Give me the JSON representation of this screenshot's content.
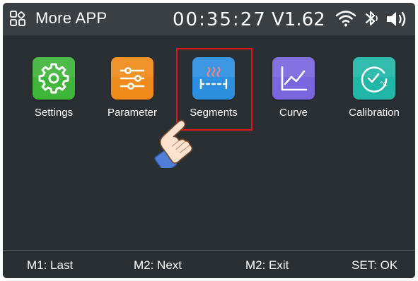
{
  "header": {
    "title": "More APP",
    "time": "00:35:27",
    "version": "V1.62",
    "icons": [
      "menu-icon",
      "wifi-icon",
      "bluetooth-icon",
      "volume-icon"
    ]
  },
  "apps": [
    {
      "label": "Settings",
      "icon": "gear-icon",
      "color": "#3fb53a"
    },
    {
      "label": "Parameter",
      "icon": "sliders-icon",
      "color": "#f08a1a"
    },
    {
      "label": "Segments",
      "icon": "heating-segments-icon",
      "color": "#2d8fe0",
      "selected": true
    },
    {
      "label": "Curve",
      "icon": "line-chart-icon",
      "color": "#7a67df"
    },
    {
      "label": "Calibration",
      "icon": "calibration-gauge-icon",
      "color": "#20b7a8"
    }
  ],
  "footer": {
    "m1": "M1: Last",
    "m2_next": "M2: Next",
    "m2_exit": "M2: Exit",
    "set": "SET: OK"
  },
  "colors": {
    "background": "#2a2f33",
    "header": "#3a3f44",
    "highlight": "#e01818"
  }
}
